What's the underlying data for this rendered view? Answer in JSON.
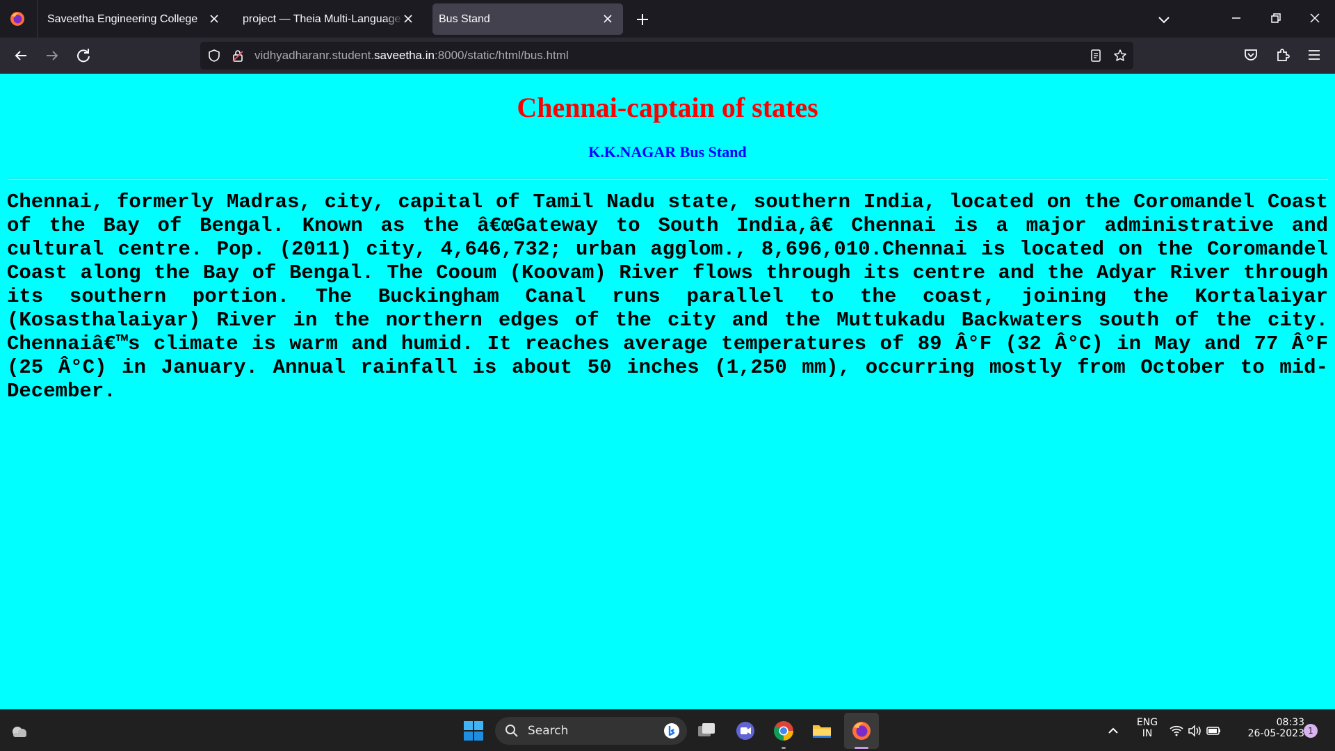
{
  "browser": {
    "tabs": [
      {
        "label": "Saveetha Engineering College"
      },
      {
        "label": "project — Theia Multi-Language Ex"
      },
      {
        "label": "Bus Stand"
      }
    ],
    "url": {
      "prefix": "vidhyadharanr.student.",
      "host": "saveetha.in",
      "suffix": ":8000/static/html/bus.html"
    }
  },
  "page": {
    "title": "Chennai-captain of states",
    "subtitle": "K.K.NAGAR Bus Stand",
    "paragraph": "Chennai, formerly Madras, city, capital of Tamil Nadu state, southern India, located on the Coromandel Coast of the Bay of Bengal. Known as the â€œGateway to South India,â€ Chennai is a major administrative and cultural centre. Pop. (2011) city, 4,646,732; urban agglom., 8,696,010.Chennai is located on the Coromandel Coast along the Bay of Bengal. The Cooum (Koovam) River flows through its centre and the Adyar River through its southern portion. The Buckingham Canal runs parallel to the coast, joining the Kortalaiyar (Kosasthalaiyar) River in the northern edges of the city and the Muttukadu Backwaters south of the city. Chennaiâ€™s climate is warm and humid. It reaches average temperatures of 89 Â°F (32 Â°C) in May and 77 Â°F (25 Â°C) in January. Annual rainfall is about 50 inches (1,250 mm), occurring mostly from October to mid-December."
  },
  "taskbar": {
    "search_label": "Search",
    "language_line1": "ENG",
    "language_line2": "IN",
    "time": "08:33",
    "date": "26-05-2023",
    "notification_count": "1"
  },
  "colors": {
    "page_background": "#00ffff",
    "title": "#ff0000",
    "subtitle": "#0000ff"
  }
}
